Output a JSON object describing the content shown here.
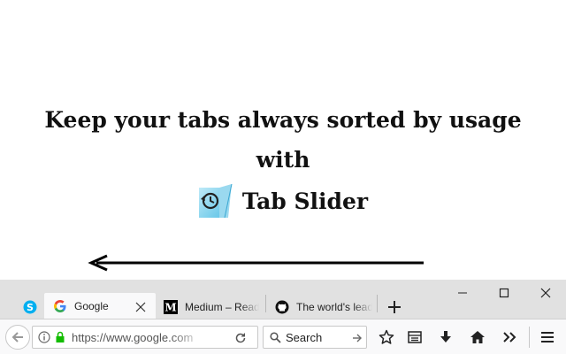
{
  "promo": {
    "line1": "Keep your tabs always sorted by usage",
    "line2": "with",
    "product_name": "Tab Slider"
  },
  "browser": {
    "tabs": [
      {
        "title": "",
        "icon": "skype-icon",
        "active": false
      },
      {
        "title": "Google",
        "icon": "google-icon",
        "active": true
      },
      {
        "title": "Medium – Read",
        "icon": "medium-icon",
        "active": false
      },
      {
        "title": "The world's leading",
        "icon": "github-icon",
        "active": false
      }
    ],
    "url": "https://www.google.com",
    "search_placeholder": "Search",
    "colors": {
      "chrome": "#e1e1e1",
      "active_tab": "#f9f9fa",
      "secure_lock": "#12bc00",
      "skype_blue": "#00aff0"
    }
  }
}
